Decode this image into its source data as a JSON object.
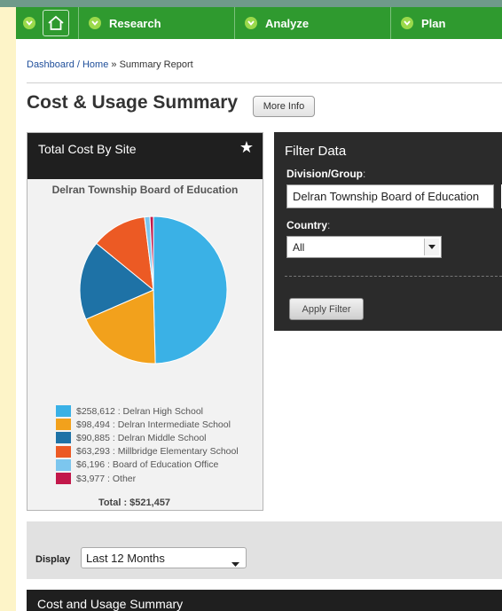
{
  "nav": {
    "items": [
      {
        "label": "Research"
      },
      {
        "label": "Analyze"
      },
      {
        "label": "Plan"
      }
    ]
  },
  "breadcrumb": {
    "link": "Dashboard / Home",
    "separator": " » ",
    "current": "Summary Report"
  },
  "page": {
    "title": "Cost & Usage Summary",
    "more_info_label": "More Info"
  },
  "total_cost_panel": {
    "title": "Total Cost By Site",
    "star": "★",
    "total_label": "Total : $521,457"
  },
  "chart_data": {
    "type": "pie",
    "title": "Delran Township Board of Education",
    "slices": [
      {
        "label": "$258,612 : Delran High School",
        "value": 258612,
        "color": "#3ab1e6"
      },
      {
        "label": "$98,494 : Delran Intermediate School",
        "value": 98494,
        "color": "#f2a11c"
      },
      {
        "label": "$90,885 : Delran Middle School",
        "value": 90885,
        "color": "#1e72a6"
      },
      {
        "label": "$63,293 : Millbridge Elementary School",
        "value": 63293,
        "color": "#ec5a24"
      },
      {
        "label": "$6,196 : Board of Education Office",
        "value": 6196,
        "color": "#7cc6ee"
      },
      {
        "label": "$3,977 : Other",
        "value": 3977,
        "color": "#c2184a"
      }
    ]
  },
  "filter": {
    "title": "Filter Data",
    "division_label": "Division/Group",
    "division_value": "Delran Township Board of Education",
    "country_label": "Country",
    "country_value": "All",
    "apply_label": "Apply Filter"
  },
  "display": {
    "label": "Display",
    "value": "Last 12 Months"
  },
  "footer": {
    "title": "Cost and Usage Summary"
  }
}
